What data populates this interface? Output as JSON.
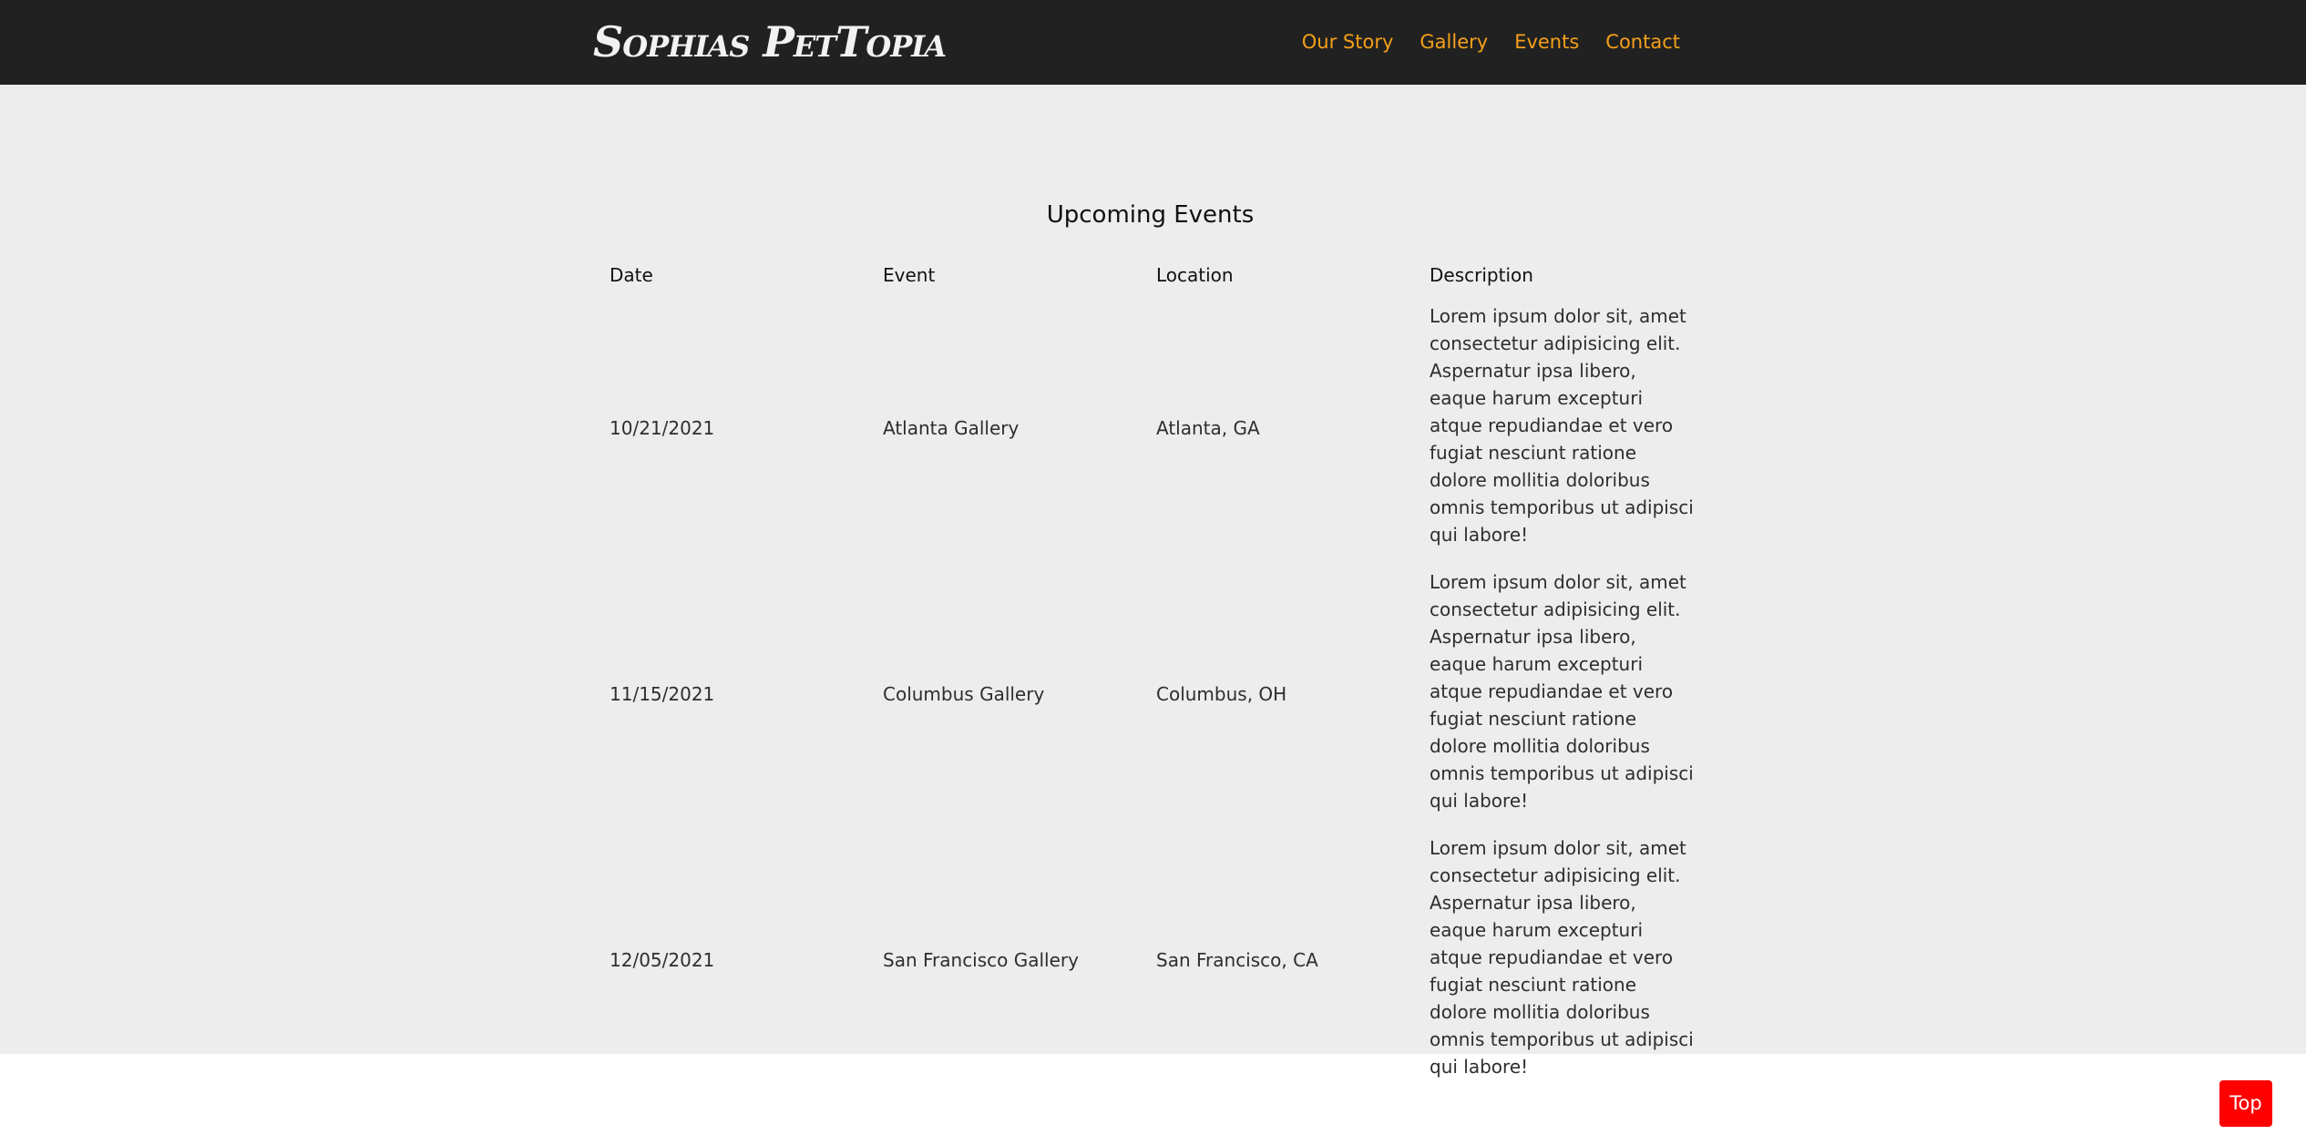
{
  "navbar": {
    "logo": "Sophias PetTopia",
    "links": [
      {
        "label": "Our Story"
      },
      {
        "label": "Gallery"
      },
      {
        "label": "Events"
      },
      {
        "label": "Contact"
      }
    ],
    "link_color": "#f5a01a",
    "background": "#212121"
  },
  "events": {
    "title": "Upcoming Events",
    "headers": [
      "Date",
      "Event",
      "Location",
      "Description"
    ],
    "rows": [
      {
        "date": "10/21/2021",
        "event": "Atlanta Gallery",
        "location": "Atlanta, GA",
        "description": "Lorem ipsum dolor sit, amet consectetur adipisicing elit. Aspernatur ipsa libero, eaque harum excepturi atque repudiandae et vero fugiat nesciunt ratione dolore mollitia doloribus omnis temporibus ut adipisci qui labore!"
      },
      {
        "date": "11/15/2021",
        "event": "Columbus Gallery",
        "location": "Columbus, OH",
        "description": "Lorem ipsum dolor sit, amet consectetur adipisicing elit. Aspernatur ipsa libero, eaque harum excepturi atque repudiandae et vero fugiat nesciunt ratione dolore mollitia doloribus omnis temporibus ut adipisci qui labore!"
      },
      {
        "date": "12/05/2021",
        "event": "San Francisco Gallery",
        "location": "San Francisco, CA",
        "description": "Lorem ipsum dolor sit, amet consectetur adipisicing elit. Aspernatur ipsa libero, eaque harum excepturi atque repudiandae et vero fugiat nesciunt ratione dolore mollitia doloribus omnis temporibus ut adipisci qui labore!"
      }
    ]
  },
  "top_button": {
    "label": "Top",
    "color": "#ff0000"
  }
}
